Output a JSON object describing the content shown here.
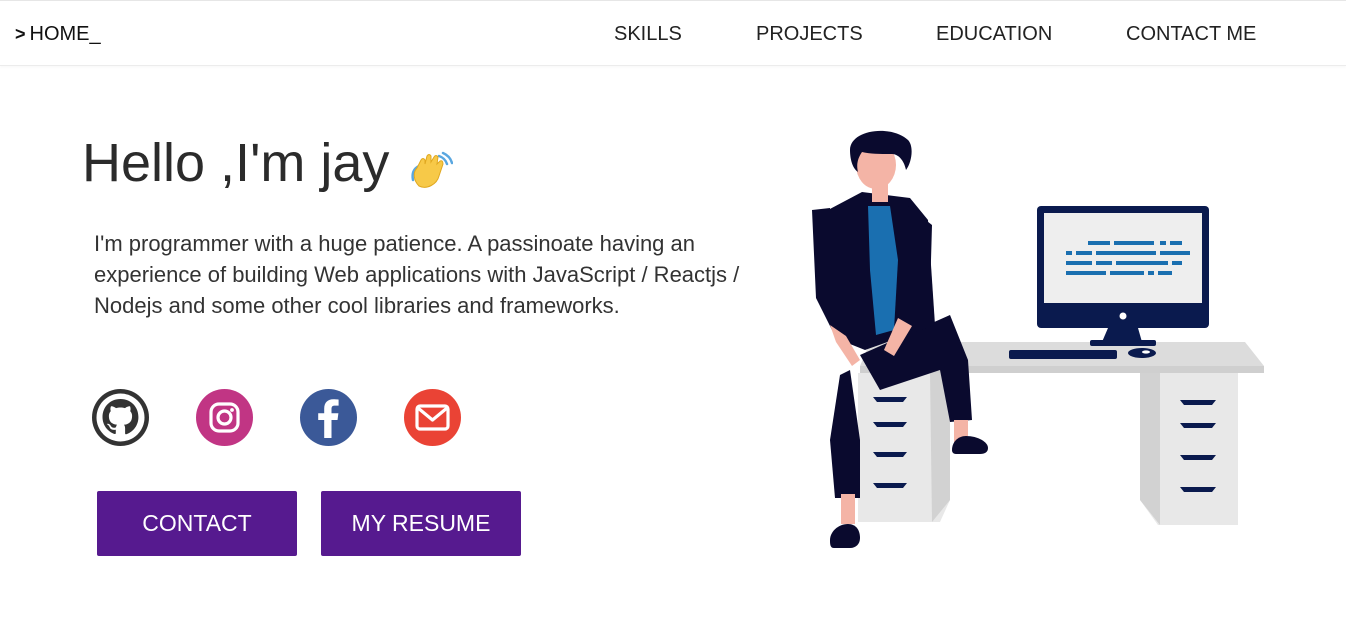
{
  "nav": {
    "brand_caret": ">",
    "brand": "HOME_",
    "links": [
      "SKILLS",
      "PROJECTS",
      "EDUCATION",
      "CONTACT ME"
    ]
  },
  "hero": {
    "greeting": "Hello ,I'm jay",
    "intro": "I'm programmer with a huge patience. A passinoate having an experience of building Web applications with JavaScript / Reactjs / Nodejs and some other cool libraries and frameworks."
  },
  "social": [
    {
      "icon": "github-icon",
      "color": "#333333"
    },
    {
      "icon": "instagram-icon",
      "color": "#c13584"
    },
    {
      "icon": "facebook-icon",
      "color": "#3b5998"
    },
    {
      "icon": "email-icon",
      "color": "#ea4335"
    }
  ],
  "buttons": {
    "contact": "CONTACT",
    "resume": "MY RESUME"
  },
  "colors": {
    "accent": "#561a8f",
    "illustration_dark": "#0a0a2e",
    "illustration_blue": "#1a6fb0"
  }
}
